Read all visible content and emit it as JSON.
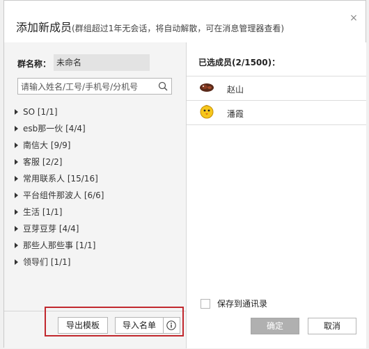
{
  "dialog": {
    "title": "添加新成员",
    "subtitle": "(群组超过1年无会话，将自动解散，可在消息管理器查看)",
    "close_glyph": "×"
  },
  "left": {
    "group_name_label": "群名称：",
    "group_name_value": "未命名",
    "search_placeholder": "请输入姓名/工号/手机号/分机号",
    "groups": [
      {
        "label": "SO [1/1]"
      },
      {
        "label": "esb那一伙 [4/4]"
      },
      {
        "label": "南信大 [9/9]"
      },
      {
        "label": "客服 [2/2]"
      },
      {
        "label": "常用联系人 [15/16]"
      },
      {
        "label": "平台组件那波人 [6/6]"
      },
      {
        "label": "生活 [1/1]"
      },
      {
        "label": "豆芽豆芽 [4/4]"
      },
      {
        "label": "那些人那些事 [1/1]"
      },
      {
        "label": "领导们 [1/1]"
      }
    ],
    "export_label": "导出模板",
    "import_label": "导入名单"
  },
  "right": {
    "selected_title": "已选成员(2/1500)：",
    "members": [
      {
        "name": "赵山",
        "avatar": "brown-bird-avatar-icon"
      },
      {
        "name": "潘霞",
        "avatar": "yellow-chick-avatar-icon"
      }
    ],
    "save_label": "保存到通讯录",
    "ok_label": "确定",
    "cancel_label": "取消"
  },
  "colors": {
    "highlight": "#c1272d",
    "disabled_button": "#b0b0b0"
  }
}
